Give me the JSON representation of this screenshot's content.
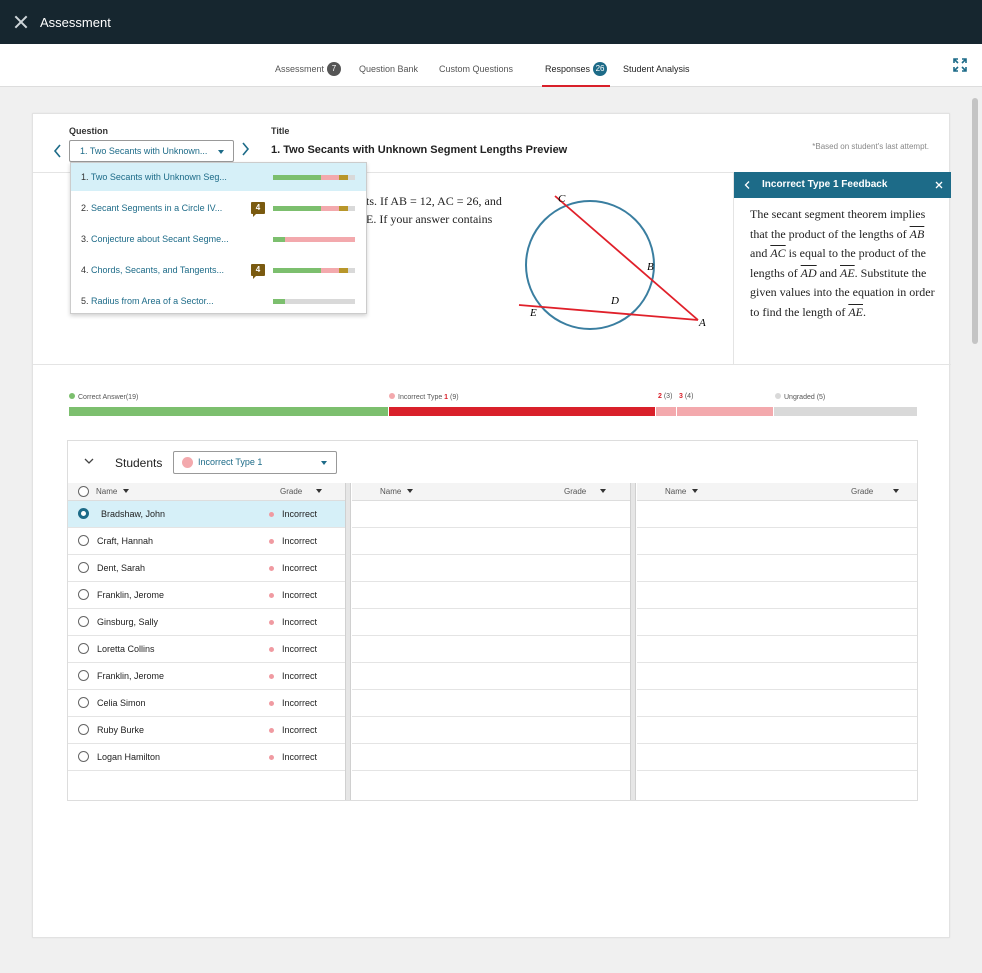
{
  "app": {
    "title": "Assessment"
  },
  "tabs": [
    {
      "label": "Assessment",
      "badge": "7"
    },
    {
      "label": "Question Bank"
    },
    {
      "label": "Custom Questions"
    },
    {
      "label": "Responses",
      "badge": "26",
      "active": true
    },
    {
      "label": "Student Analysis"
    }
  ],
  "question_header": {
    "question_label": "Question",
    "selected": "1. Two Secants with Unknown...",
    "title_label": "Title",
    "title": "1. Two Secants with Unknown Segment Lengths Preview",
    "note": "*Based on student's last attempt."
  },
  "question_dropdown": [
    {
      "num": "1.",
      "label": "Two Secants with Unknown Seg...",
      "selected": true,
      "bar": [
        0.58,
        0.23,
        0.11,
        0.08
      ]
    },
    {
      "num": "2.",
      "label": "Secant Segments in a Circle IV...",
      "badge": "4",
      "bar": [
        0.58,
        0.23,
        0.11,
        0.08
      ]
    },
    {
      "num": "3.",
      "label": "Conjecture about Secant Segme...",
      "bar": [
        0.15,
        0.85,
        0,
        0
      ]
    },
    {
      "num": "4.",
      "label": "Chords, Secants, and Tangents...",
      "badge": "4",
      "bar": [
        0.58,
        0.23,
        0.11,
        0.08
      ]
    },
    {
      "num": "5.",
      "label": "Radius from Area of a Sector...",
      "bar": [
        0.15,
        0,
        0,
        0.85
      ]
    }
  ],
  "question_text": {
    "line1": "ts. If AB = 12, AC = 26, and",
    "line2": "E. If your answer contains"
  },
  "diagram_labels": {
    "C": "C",
    "B": "B",
    "D": "D",
    "E": "E",
    "A": "A"
  },
  "feedback": {
    "title": "Incorrect Type 1 Feedback",
    "body_1": "The secant segment theorem implies that the product of the lengths of ",
    "seg_ab": "AB",
    "body_2": " and ",
    "seg_ac": "AC",
    "body_3": " is equal to the product of the lengths of ",
    "seg_ad": "AD",
    "body_4": " and ",
    "seg_ae": "AE",
    "body_5": ". Substitute the given values into the equation in order to find the length of ",
    "seg_ae2": "AE",
    "body_6": "."
  },
  "legend": {
    "correct": "Correct Answer(19)",
    "incorrect1_label": "Incorrect Type ",
    "incorrect1_num": "1",
    "incorrect1_count": " (9)",
    "incorrect2_num": "2",
    "incorrect2_count": " (3)",
    "incorrect3_num": "3",
    "incorrect3_count": " (4)",
    "ungraded": "Ungraded (5)"
  },
  "distribution": {
    "correct": 19,
    "incorrect_1": 9,
    "incorrect_2": 3,
    "incorrect_3": 4,
    "ungraded": 5
  },
  "students": {
    "label": "Students",
    "filter": "Incorrect Type 1",
    "col_name": "Name",
    "col_grade": "Grade",
    "rows": [
      {
        "name": "Bradshaw, John",
        "grade": "Incorrect",
        "selected": true
      },
      {
        "name": "Craft, Hannah",
        "grade": "Incorrect"
      },
      {
        "name": "Dent, Sarah",
        "grade": "Incorrect"
      },
      {
        "name": "Franklin, Jerome",
        "grade": "Incorrect"
      },
      {
        "name": "Ginsburg, Sally",
        "grade": "Incorrect"
      },
      {
        "name": "Loretta Collins",
        "grade": "Incorrect"
      },
      {
        "name": "Franklin, Jerome",
        "grade": "Incorrect"
      },
      {
        "name": "Celia Simon",
        "grade": "Incorrect"
      },
      {
        "name": "Ruby Burke",
        "grade": "Incorrect"
      },
      {
        "name": "Logan Hamilton",
        "grade": "Incorrect"
      }
    ]
  },
  "colors": {
    "correct": "#7cbf6e",
    "incorrect": "#d9202a",
    "incorrect_light": "#f3a9ad",
    "ungraded": "#d9d9d9",
    "teal": "#1d6b88",
    "brown": "#b8962a"
  }
}
